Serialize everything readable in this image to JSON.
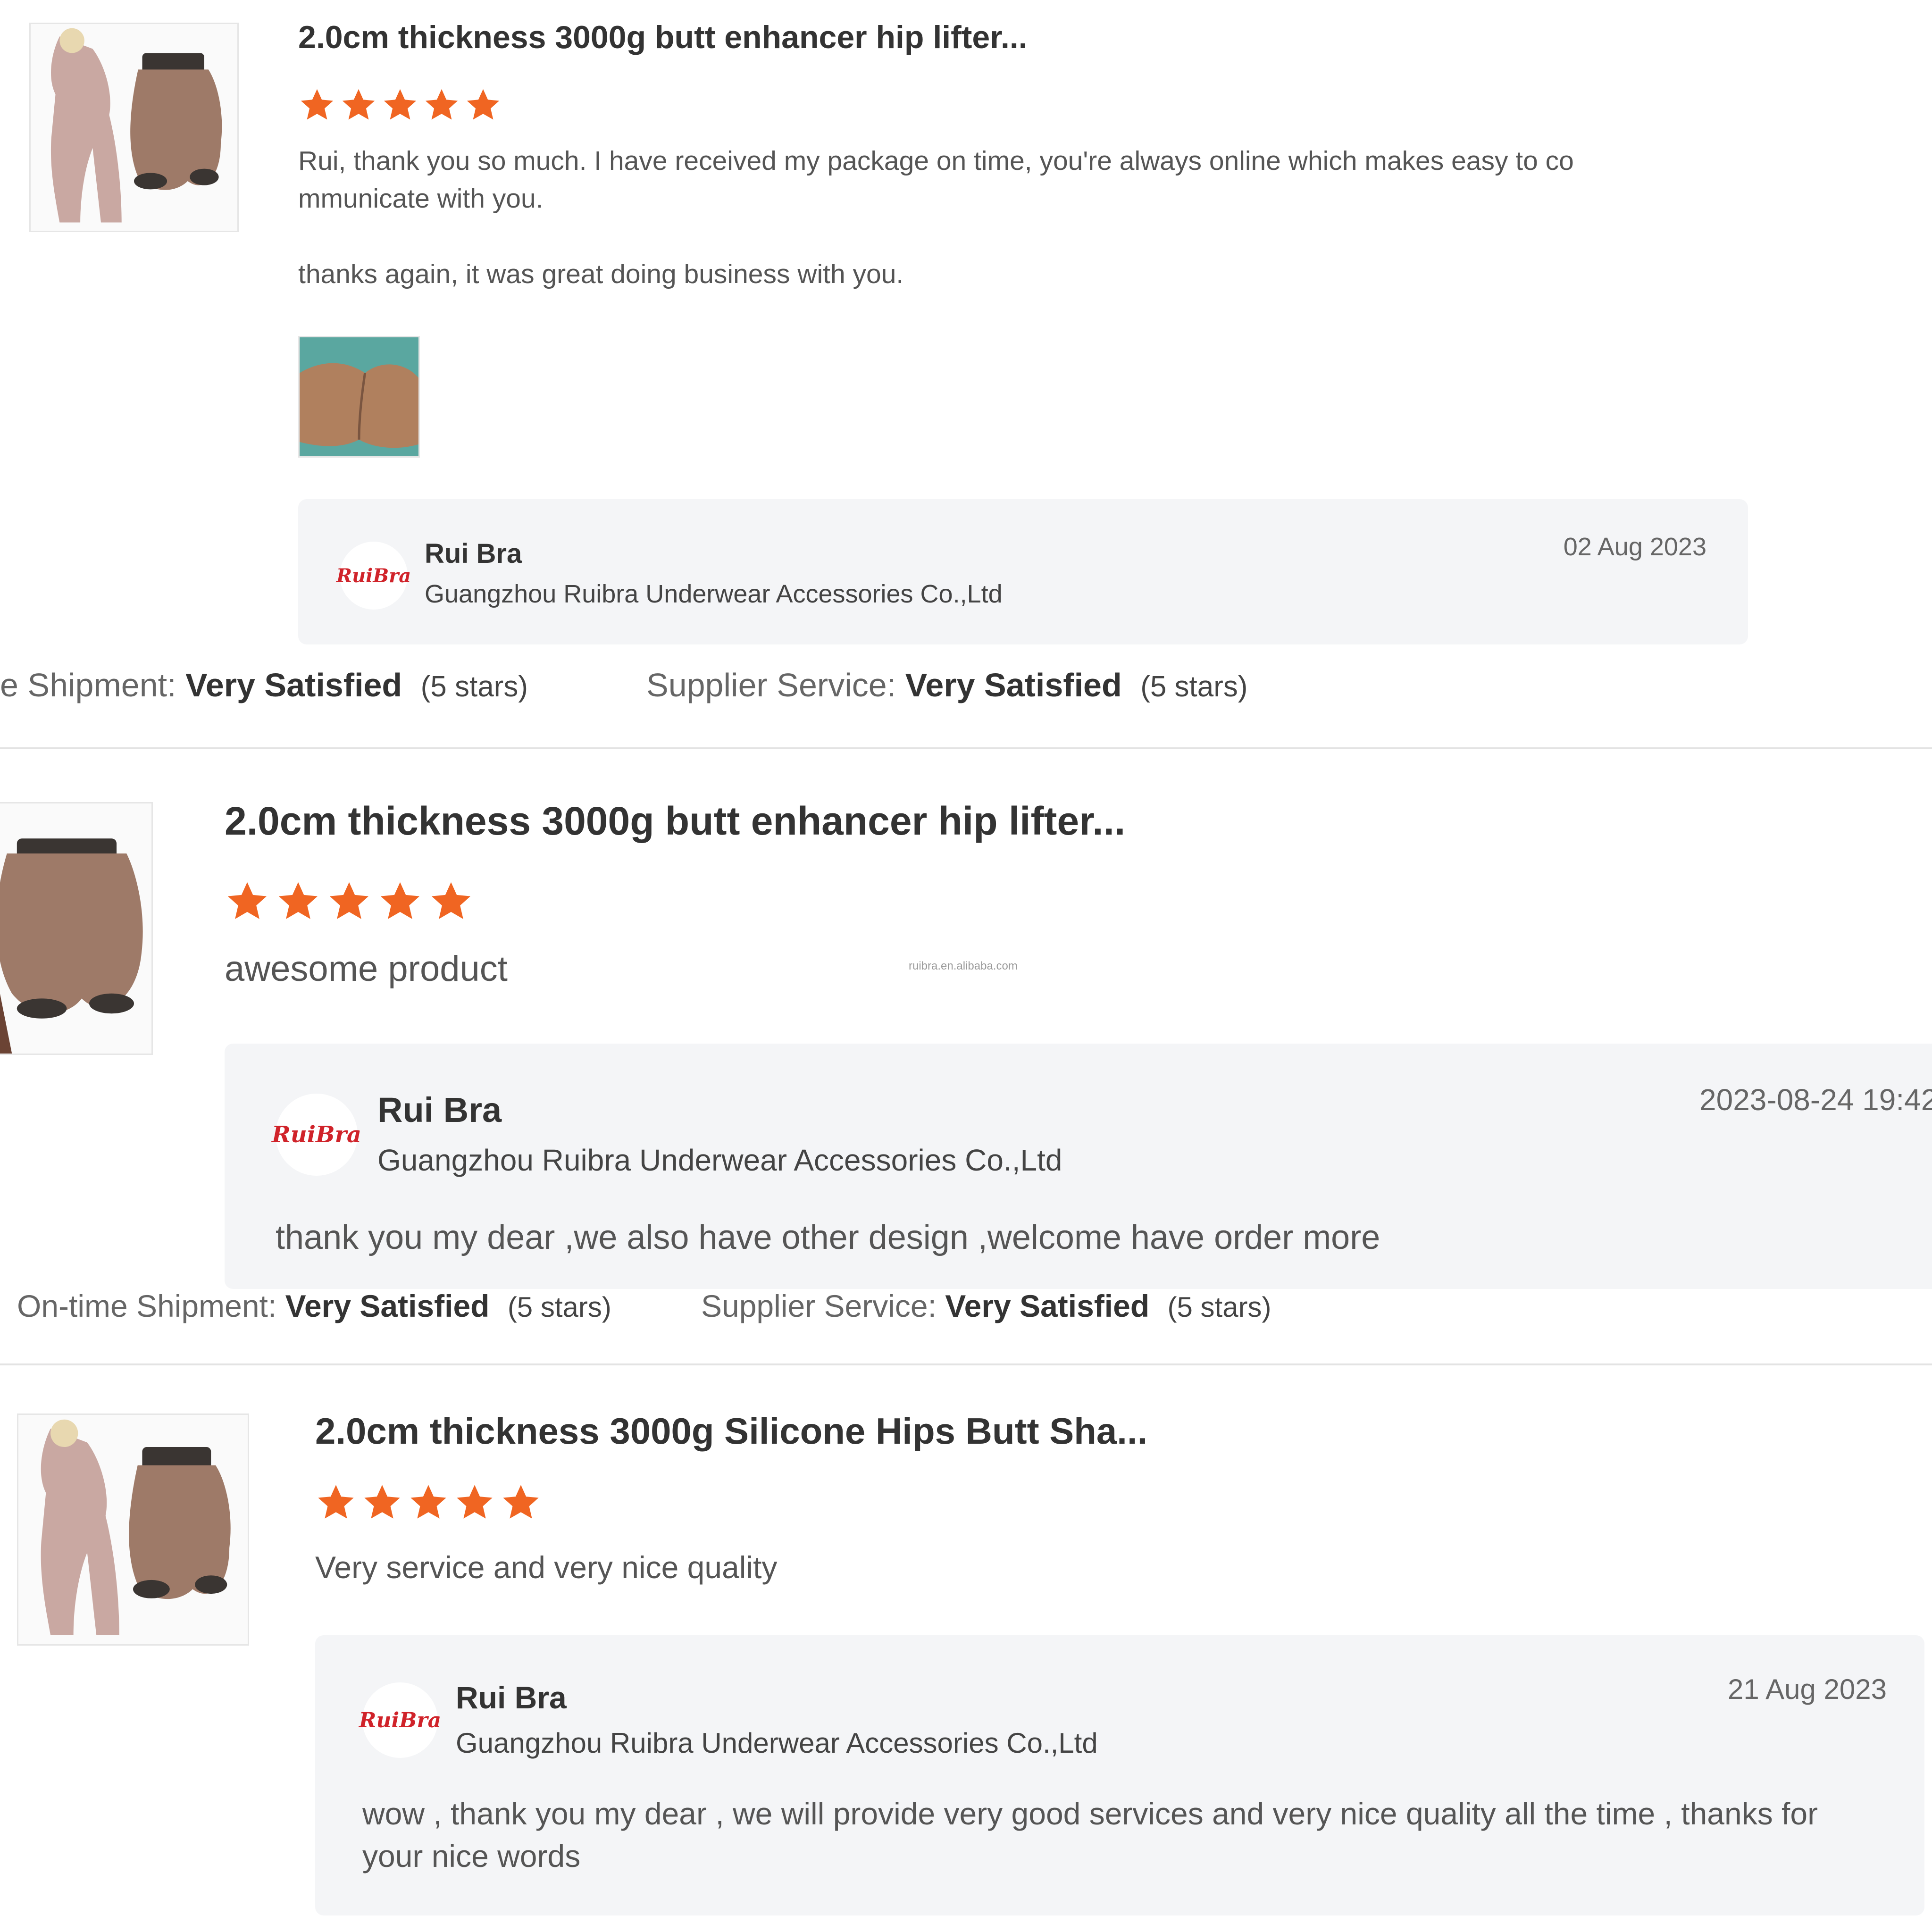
{
  "watermark": "ruibra.en.alibaba.com",
  "colors": {
    "star": "#f06522",
    "panel_bg": "#f4f5f7",
    "logo_red": "#d0232a"
  },
  "reviews": [
    {
      "title": "2.0cm thickness 3000g butt enhancer hip lifter...",
      "rating": 5,
      "text_lines": [
        "Rui, thank you so much. I have received my package on time, you're always online which makes easy to co",
        "mmunicate with you.",
        "thanks again, it was great doing business with you."
      ],
      "reply": {
        "logo": "RuiBra",
        "name": "Rui Bra",
        "company": "Guangzhou Ruibra Underwear Accessories Co.,Ltd",
        "date": "02 Aug 2023"
      },
      "ratings": {
        "shipment_label": "e Shipment:",
        "shipment_value": "Very Satisfied",
        "shipment_stars": "(5 stars)",
        "service_label": "Supplier Service:",
        "service_value": "Very Satisfied",
        "service_stars": "(5 stars)"
      }
    },
    {
      "title": "2.0cm thickness 3000g butt enhancer hip lifter...",
      "rating": 5,
      "text": "awesome product",
      "reply": {
        "logo": "RuiBra",
        "name": "Rui Bra",
        "company": "Guangzhou Ruibra Underwear Accessories Co.,Ltd",
        "date": "2023-08-24 19:42",
        "message": "thank you my dear ,we also have other design ,welcome have order more"
      },
      "ratings": {
        "shipment_label": "On-time Shipment:",
        "shipment_value": "Very Satisfied",
        "shipment_stars": "(5 stars)",
        "service_label": "Supplier Service:",
        "service_value": "Very Satisfied",
        "service_stars": "(5 stars)"
      }
    },
    {
      "title": "2.0cm thickness 3000g Silicone Hips Butt Sha...",
      "rating": 5,
      "text": "Very service and very nice quality",
      "reply": {
        "logo": "RuiBra",
        "name": "Rui Bra",
        "company": "Guangzhou Ruibra Underwear Accessories Co.,Ltd",
        "date": "21 Aug 2023",
        "message_lines": [
          "wow , thank you my dear , we will provide very good services and very nice quality all the time , thanks for",
          "your nice words"
        ]
      }
    }
  ]
}
